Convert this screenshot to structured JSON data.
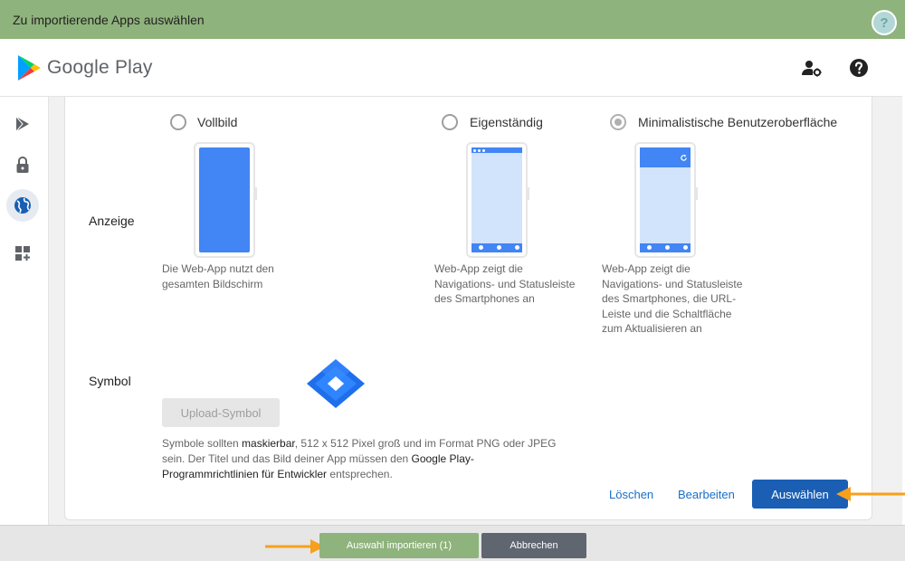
{
  "window": {
    "title": "Zu importierende Apps auswählen",
    "help_label": "?"
  },
  "header": {
    "logo_text": "Google Play",
    "icons": [
      "user-settings-icon",
      "help-icon"
    ]
  },
  "sidebar": {
    "items": [
      {
        "icon": "play-icon",
        "active": false
      },
      {
        "icon": "lock-icon",
        "active": false
      },
      {
        "icon": "globe-icon",
        "active": true
      },
      {
        "icon": "add-apps-icon",
        "active": false
      }
    ]
  },
  "display": {
    "label": "Anzeige",
    "options": [
      {
        "label": "Vollbild",
        "selected": false,
        "description_lines": [
          "Die Web-App nutzt den",
          "gesamten Bildschirm"
        ]
      },
      {
        "label": "Eigenständig",
        "selected": false,
        "description_lines": [
          "Web-App zeigt die",
          "Navigations- und Statusleiste",
          "des Smartphones an"
        ]
      },
      {
        "label": "Minimalistische Benutzeroberfläche",
        "selected": true,
        "description_lines": [
          "Web-App zeigt die",
          "Navigations- und Statusleiste",
          "des Smartphones, die URL-",
          "Leiste und die Schaltfläche",
          "zum Aktualisieren an"
        ]
      }
    ]
  },
  "icon_section": {
    "label": "Symbol",
    "upload_label": "Upload-Symbol",
    "note": {
      "part1": "Symbole sollten ",
      "link1": "maskierbar",
      "part2": ", 512 x 512 Pixel groß und im Format PNG oder JPEG sein. Der Titel und das Bild deiner App müssen den ",
      "link2": "Google Play-Programmrichtlinien für Entwickler",
      "part3": " entsprechen."
    }
  },
  "actions": {
    "delete_label": "Löschen",
    "edit_label": "Bearbeiten",
    "select_label": "Auswählen"
  },
  "footer": {
    "import_label": "Auswahl importieren (1)",
    "cancel_label": "Abbrechen"
  },
  "colors": {
    "titlebar": "#8fb37c",
    "primary": "#1a5fb4",
    "phone_screen": "#4285f4",
    "phone_screen_light": "#d2e3fc",
    "arrow": "#f7a01c"
  }
}
